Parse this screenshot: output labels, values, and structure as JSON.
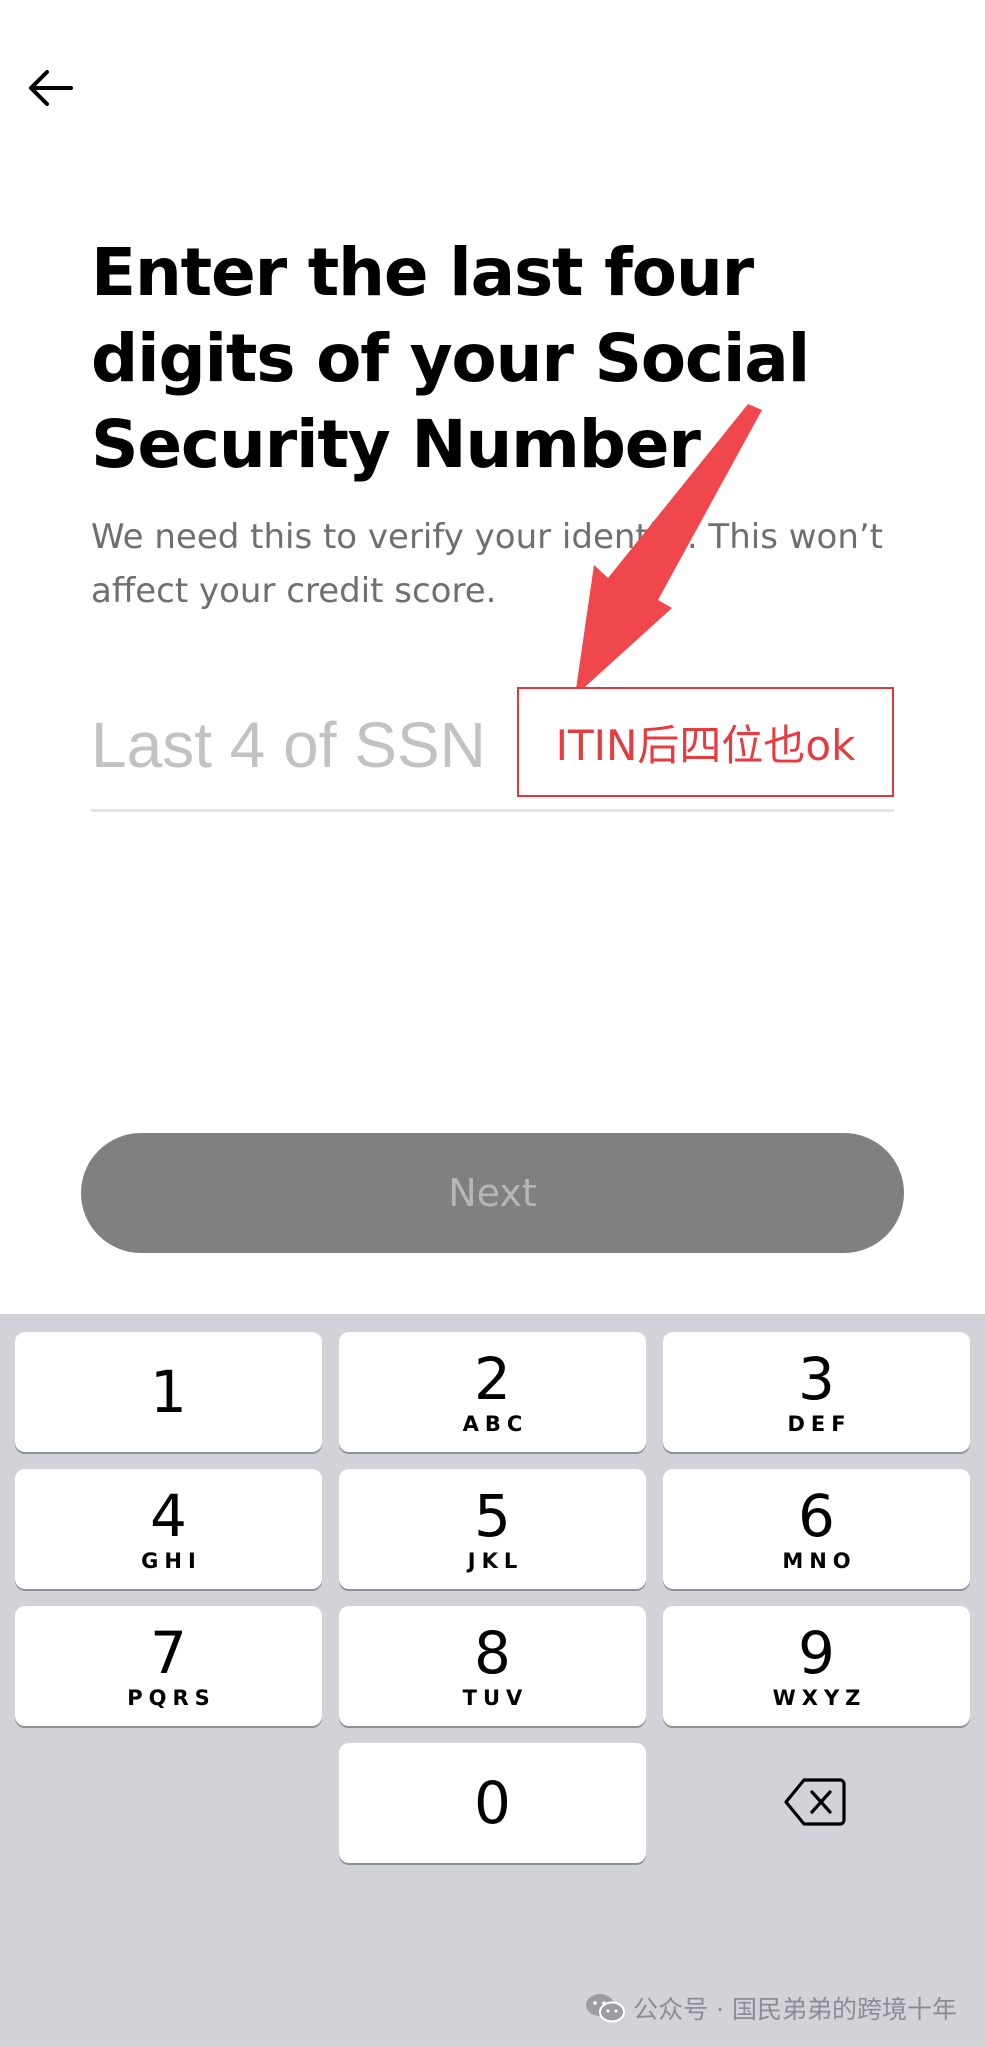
{
  "header": {
    "back_icon": "arrow-left-icon"
  },
  "content": {
    "title": "Enter the last four digits of your Social Security Number",
    "subtitle": "We need this to verify your identity. This won’t affect your credit score."
  },
  "ssn_field": {
    "placeholder": "Last 4 of SSN",
    "value": ""
  },
  "annotation": {
    "text": "ITIN后四位也ok",
    "color": "#e63c3f"
  },
  "next_button": {
    "label": "Next"
  },
  "keypad": {
    "keys": [
      {
        "digit": "1",
        "letters": ""
      },
      {
        "digit": "2",
        "letters": "ABC"
      },
      {
        "digit": "3",
        "letters": "DEF"
      },
      {
        "digit": "4",
        "letters": "GHI"
      },
      {
        "digit": "5",
        "letters": "JKL"
      },
      {
        "digit": "6",
        "letters": "MNO"
      },
      {
        "digit": "7",
        "letters": "PQRS"
      },
      {
        "digit": "8",
        "letters": "TUV"
      },
      {
        "digit": "9",
        "letters": "WXYZ"
      },
      {
        "digit": "0",
        "letters": ""
      }
    ],
    "delete_icon": "backspace-icon"
  },
  "watermark": {
    "text": "公众号 · 国民弟弟的跨境十年",
    "icon": "wechat-icon"
  }
}
